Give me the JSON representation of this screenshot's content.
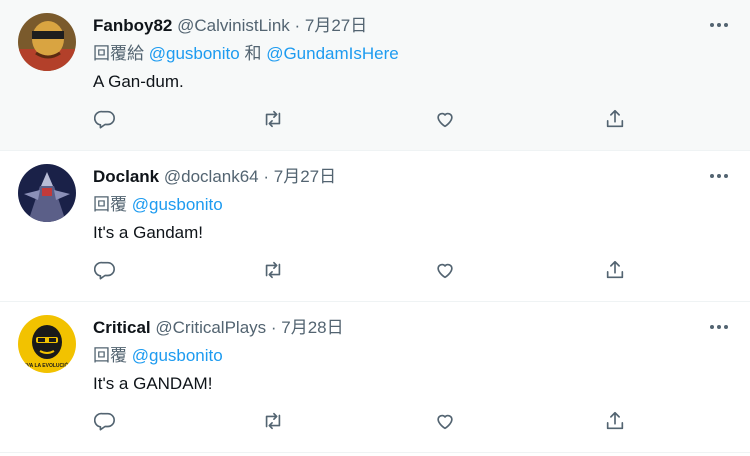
{
  "tweets": [
    {
      "name": "Fanboy82",
      "handle": "@CalvinistLink",
      "dot": " · ",
      "date": "7月27日",
      "reply_prefix": "回覆給 ",
      "mention1": "@gusbonito",
      "joiner": " 和 ",
      "mention2": "@GundamIsHere",
      "text": "A Gan-dum."
    },
    {
      "name": "Doclank",
      "handle": "@doclank64",
      "dot": " · ",
      "date": "7月27日",
      "reply_prefix": "回覆 ",
      "mention1": "@gusbonito",
      "text": "It's a Gandam!"
    },
    {
      "name": "Critical",
      "handle": "@CriticalPlays",
      "dot": " · ",
      "date": "7月28日",
      "reply_prefix": "回覆 ",
      "mention1": "@gusbonito",
      "text": "It's a GANDAM!",
      "avatar_text": "VIVA LA EVOLUCIÓN"
    }
  ],
  "colors": {
    "link": "#1d9bf0",
    "muted": "#536471",
    "highlight_bg": "#f7f9f9"
  },
  "icons": [
    "reply-icon",
    "retweet-icon",
    "like-icon",
    "share-icon",
    "more-icon"
  ]
}
